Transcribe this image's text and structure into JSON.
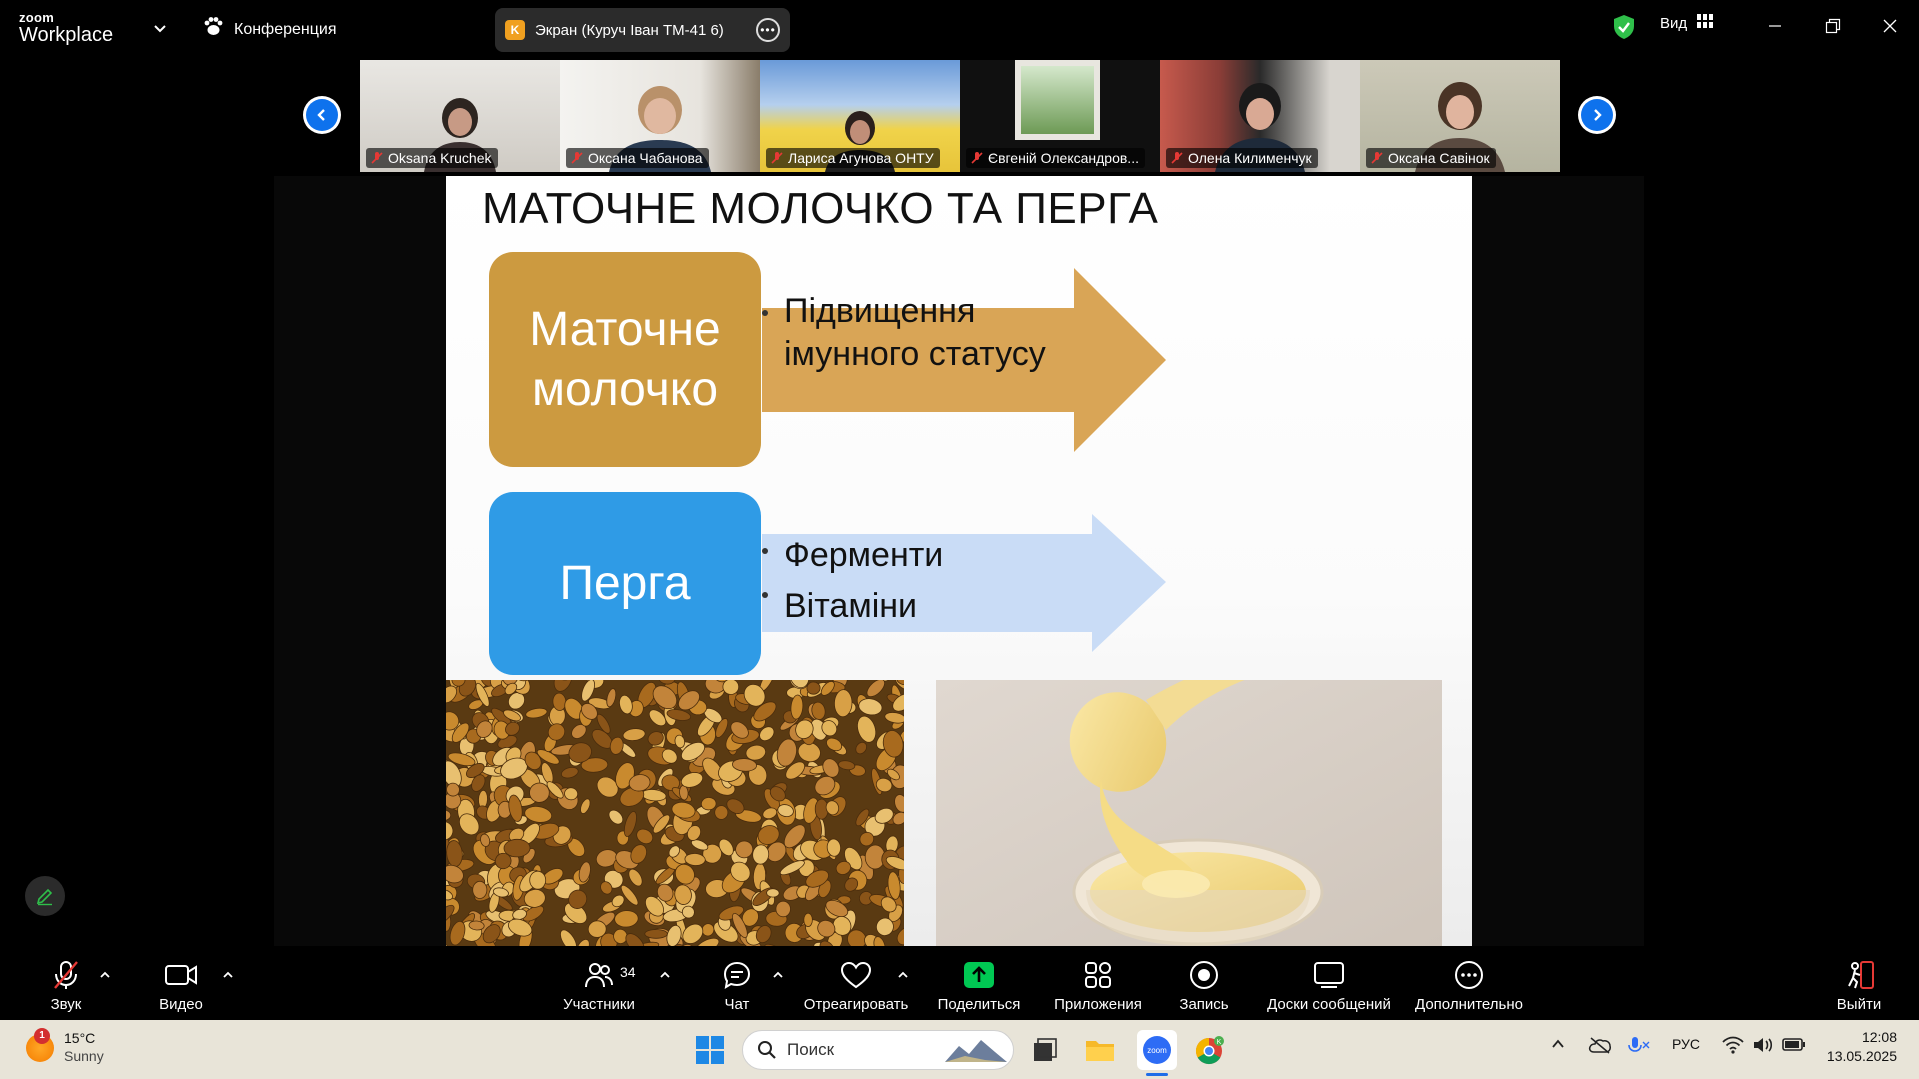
{
  "app": {
    "logo_small": "zoom",
    "logo_big": "Workplace",
    "conference_label": "Конференция",
    "screen_share_label": "Экран (Куруч Іван ТМ-41 6)",
    "screen_share_badge": "K",
    "view_label": "Вид"
  },
  "participants_strip": [
    {
      "name": "Oksana Kruchek"
    },
    {
      "name": "Оксана Чабанова"
    },
    {
      "name": "Лариса Агунова ОНТУ"
    },
    {
      "name": "Євгеній Олександров..."
    },
    {
      "name": "Олена Килименчук"
    },
    {
      "name": "Оксана Савінок"
    }
  ],
  "slide": {
    "title": "МАТОЧНЕ МОЛОЧКО ТА ПЕРГА",
    "box1_line1": "Маточне",
    "box1_line2": "молочко",
    "arrow1_line1": "Підвищення",
    "arrow1_line2": "імунного статусу",
    "box2_label": "Перга",
    "arrow2_line1": "Ферменти",
    "arrow2_line2": "Вітаміни"
  },
  "toolbar": {
    "audio_label": "Звук",
    "video_label": "Видео",
    "participants_label": "Участники",
    "participants_count": "34",
    "chat_label": "Чат",
    "react_label": "Отреагировать",
    "share_label": "Поделиться",
    "apps_label": "Приложения",
    "record_label": "Запись",
    "whiteboard_label": "Доски сообщений",
    "more_label": "Дополнительно",
    "leave_label": "Выйти"
  },
  "taskbar": {
    "weather_temp": "15°C",
    "weather_cond": "Sunny",
    "weather_badge": "1",
    "search_placeholder": "Поиск",
    "language": "РУС",
    "time": "12:08",
    "date": "13.05.2025"
  },
  "colors": {
    "zoom_blue": "#0e72ed",
    "share_green": "#00c853",
    "box1": "#cc9a40",
    "box2": "#2f9be6",
    "arrow1": "#d9a556",
    "arrow2": "#c9dcf6"
  },
  "icons": [
    "chevron-down-icon",
    "paw-icon",
    "dots-icon",
    "shield-check-icon",
    "grid-icon",
    "minimize-icon",
    "restore-icon",
    "close-icon",
    "chevron-left-icon",
    "chevron-right-icon",
    "mic-muted-icon",
    "pencil-icon",
    "camera-icon",
    "people-icon",
    "chat-icon",
    "heart-icon",
    "share-up-icon",
    "apps-icon",
    "record-icon",
    "whiteboard-icon",
    "more-icon",
    "exit-icon",
    "search-icon",
    "windows-icon",
    "wifi-icon",
    "volume-icon",
    "battery-icon"
  ]
}
